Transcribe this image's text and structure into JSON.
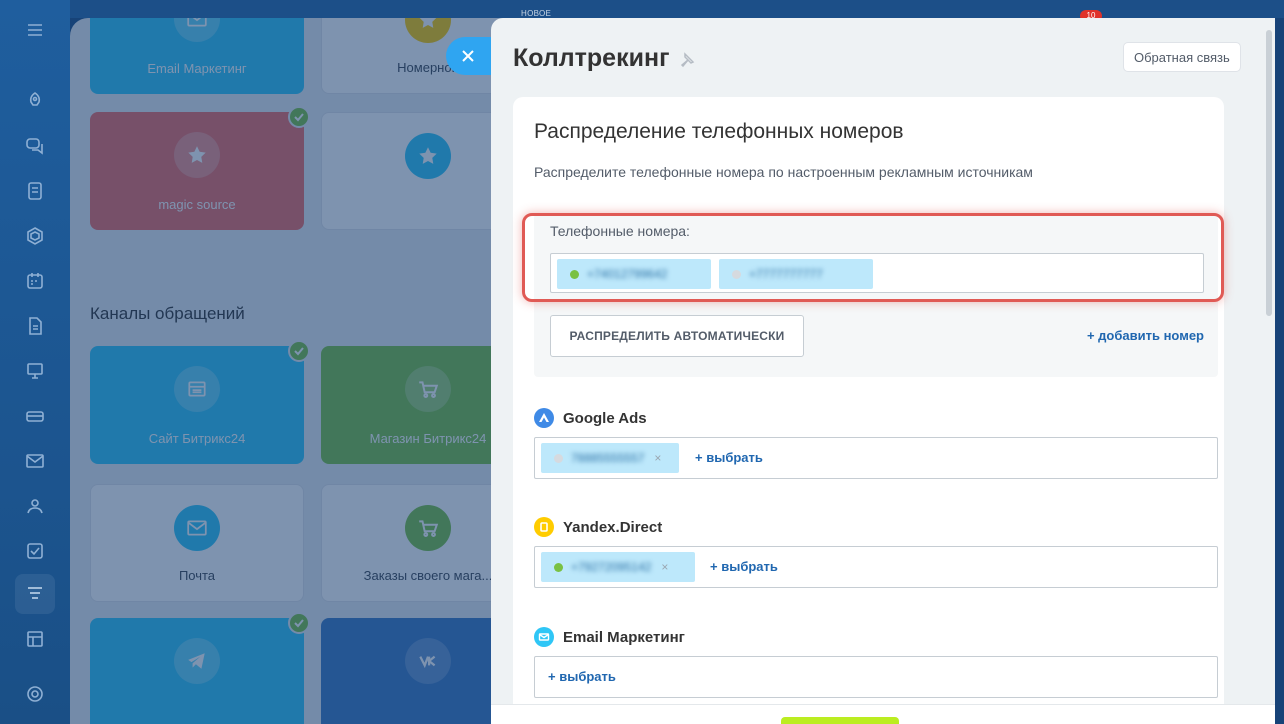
{
  "rail": {
    "icons": [
      "menu-icon",
      "rocket-icon",
      "chat-icon",
      "tasks-icon",
      "crm-icon",
      "calendar-icon",
      "docs-icon",
      "presentation-icon",
      "cards-icon",
      "mail-icon",
      "contacts-icon",
      "checkbox-icon",
      "funnel-icon",
      "sites-icon",
      "settings-icon"
    ]
  },
  "background": {
    "new_label": "НОВОЕ",
    "notification_count": "10",
    "tiles_row1": [
      {
        "label": "Email Маркетинг",
        "color": "#2fc6f6",
        "icon": "mail-icon"
      },
      {
        "label": "Номерной",
        "color": "#ffffff",
        "icon": "star-icon"
      }
    ],
    "tiles_row2": [
      {
        "label": "magic source",
        "color": "#ef6b65",
        "icon": "star-icon",
        "checked": true
      },
      {
        "label": "",
        "color": "#ffffff",
        "icon": "star-icon"
      }
    ],
    "section_title": "Каналы обращений",
    "tiles_row3": [
      {
        "label": "Сайт Битрикс24",
        "color": "#2fc6f6",
        "icon": "site-icon",
        "checked": true
      },
      {
        "label": "Магазин Битрикс24",
        "color": "#7ac143",
        "icon": "cart-icon",
        "checked": true
      }
    ],
    "tiles_row4": [
      {
        "label": "Почта",
        "color": "#ffffff",
        "icon": "mail-icon"
      },
      {
        "label": "Заказы своего мага...",
        "color": "#ffffff",
        "icon": "cart-icon"
      }
    ],
    "tiles_row5": [
      {
        "label": "",
        "color": "#2fc6f6",
        "icon": "telegram-icon",
        "checked": true
      },
      {
        "label": "",
        "color": "#3b78c2",
        "icon": "vk-icon"
      }
    ]
  },
  "panel": {
    "title": "Коллтрекинг",
    "feedback_label": "Обратная связь",
    "card": {
      "title": "Распределение телефонных номеров",
      "description": "Распределите телефонные номера по настроенным рекламным источникам",
      "numbers_label": "Телефонные номера:",
      "numbers": [
        {
          "value": "+74012799642",
          "status_color": "#7ac143"
        },
        {
          "value": "+7777777777",
          "status_color": "#d6dadf"
        }
      ],
      "auto_button": "РАСПРЕДЕЛИТЬ АВТОМАТИЧЕСКИ",
      "add_number": "добавить номер",
      "sources": [
        {
          "name": "Google Ads",
          "icon_color": "#3f8ae6",
          "selected": [
            {
              "value": "78885555557",
              "status_color": "#d6dadf"
            }
          ],
          "select_label": "выбрать"
        },
        {
          "name": "Yandex.Direct",
          "icon_color": "#ffcc00",
          "selected": [
            {
              "value": "+79272095142",
              "status_color": "#7ac143"
            }
          ],
          "select_label": "выбрать"
        },
        {
          "name": "Email Маркетинг",
          "icon_color": "#2fc6f6",
          "selected": [],
          "select_label": "выбрать"
        }
      ]
    }
  }
}
